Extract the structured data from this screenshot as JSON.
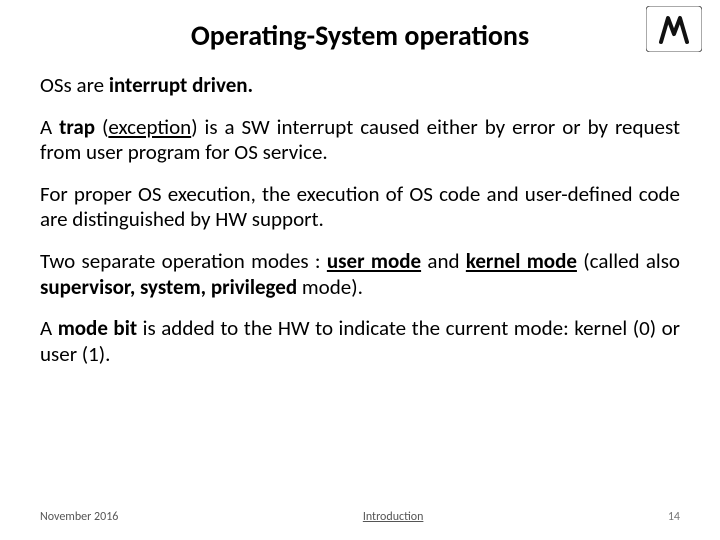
{
  "title": "Operating-System operations",
  "paragraphs": {
    "p1": {
      "a": "OSs are ",
      "b": "interrupt driven."
    },
    "p2": {
      "a": "A ",
      "b": "trap",
      "c": " (",
      "d": "exception",
      "e": ") is a SW interrupt caused either by error or by request from user program for OS service."
    },
    "p3": "For proper OS execution, the execution of OS code and user-defined code are distinguished by HW support.",
    "p4": {
      "a": "Two separate operation modes : ",
      "b": "user mode",
      "c": " and ",
      "d": "kernel mode",
      "e": " (called also ",
      "f": "supervisor, system, privileged",
      "g": " mode)."
    },
    "p5": {
      "a": "A ",
      "b": "mode bit",
      "c": " is added to the HW to indicate the current mode: kernel (0) or user (1)."
    }
  },
  "footer": {
    "left": "November 2016",
    "center": "Introduction",
    "right": "14"
  },
  "logo_alt": "technion-logo"
}
